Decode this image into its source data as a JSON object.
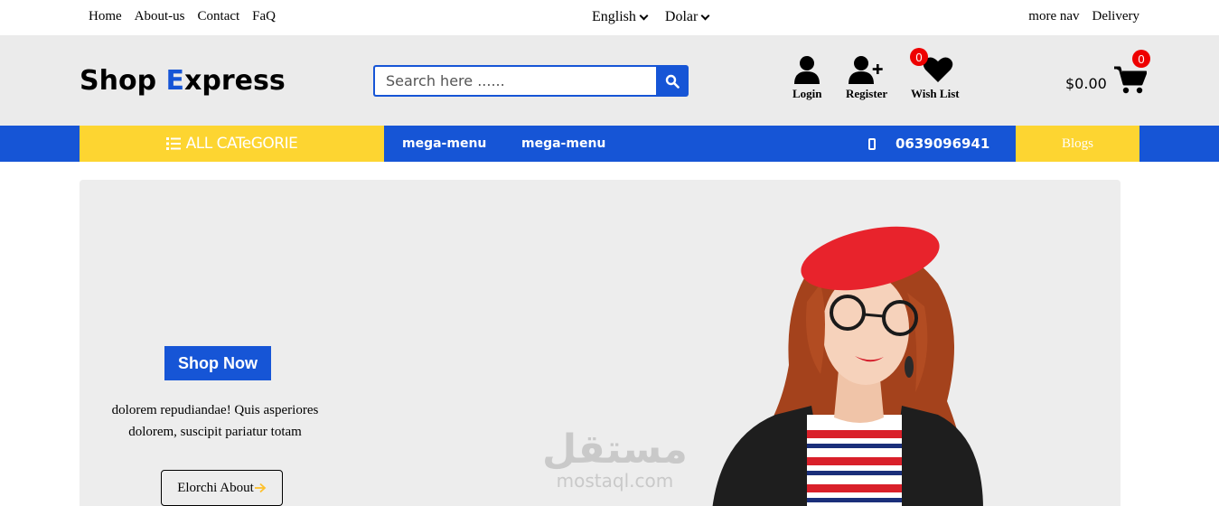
{
  "topbar": {
    "left_links": [
      "Home",
      "About-us",
      "Contact",
      "FaQ"
    ],
    "language": "English",
    "currency": "Dolar",
    "right_links": [
      "more nav",
      "Delivery"
    ]
  },
  "header": {
    "logo_part1": "Shop ",
    "logo_e": "E",
    "logo_part2": "xpress",
    "search_placeholder": "Search here ......",
    "login_label": "Login",
    "register_label": "Register",
    "wishlist_label": "Wish List",
    "wishlist_count": "0",
    "cart_total": "$0.00",
    "cart_count": "0"
  },
  "nav": {
    "all_categories": "ALL CATeGORIE",
    "mega_menu_1": "mega-menu",
    "mega_menu_2": "mega-menu",
    "phone": "0639096941",
    "blogs": "Blogs"
  },
  "hero": {
    "shop_now": "Shop Now",
    "text": "dolorem repudiandae! Quis asperiores dolorem, suscipit pariatur totam",
    "about_button": "Elorchi About",
    "watermark_arabic": "مستقل",
    "watermark_latin": "mostaql.com"
  },
  "colors": {
    "primary": "#1655d6",
    "accent": "#fdd531",
    "header_bg": "#ebebeb",
    "badge": "#ee0000"
  }
}
